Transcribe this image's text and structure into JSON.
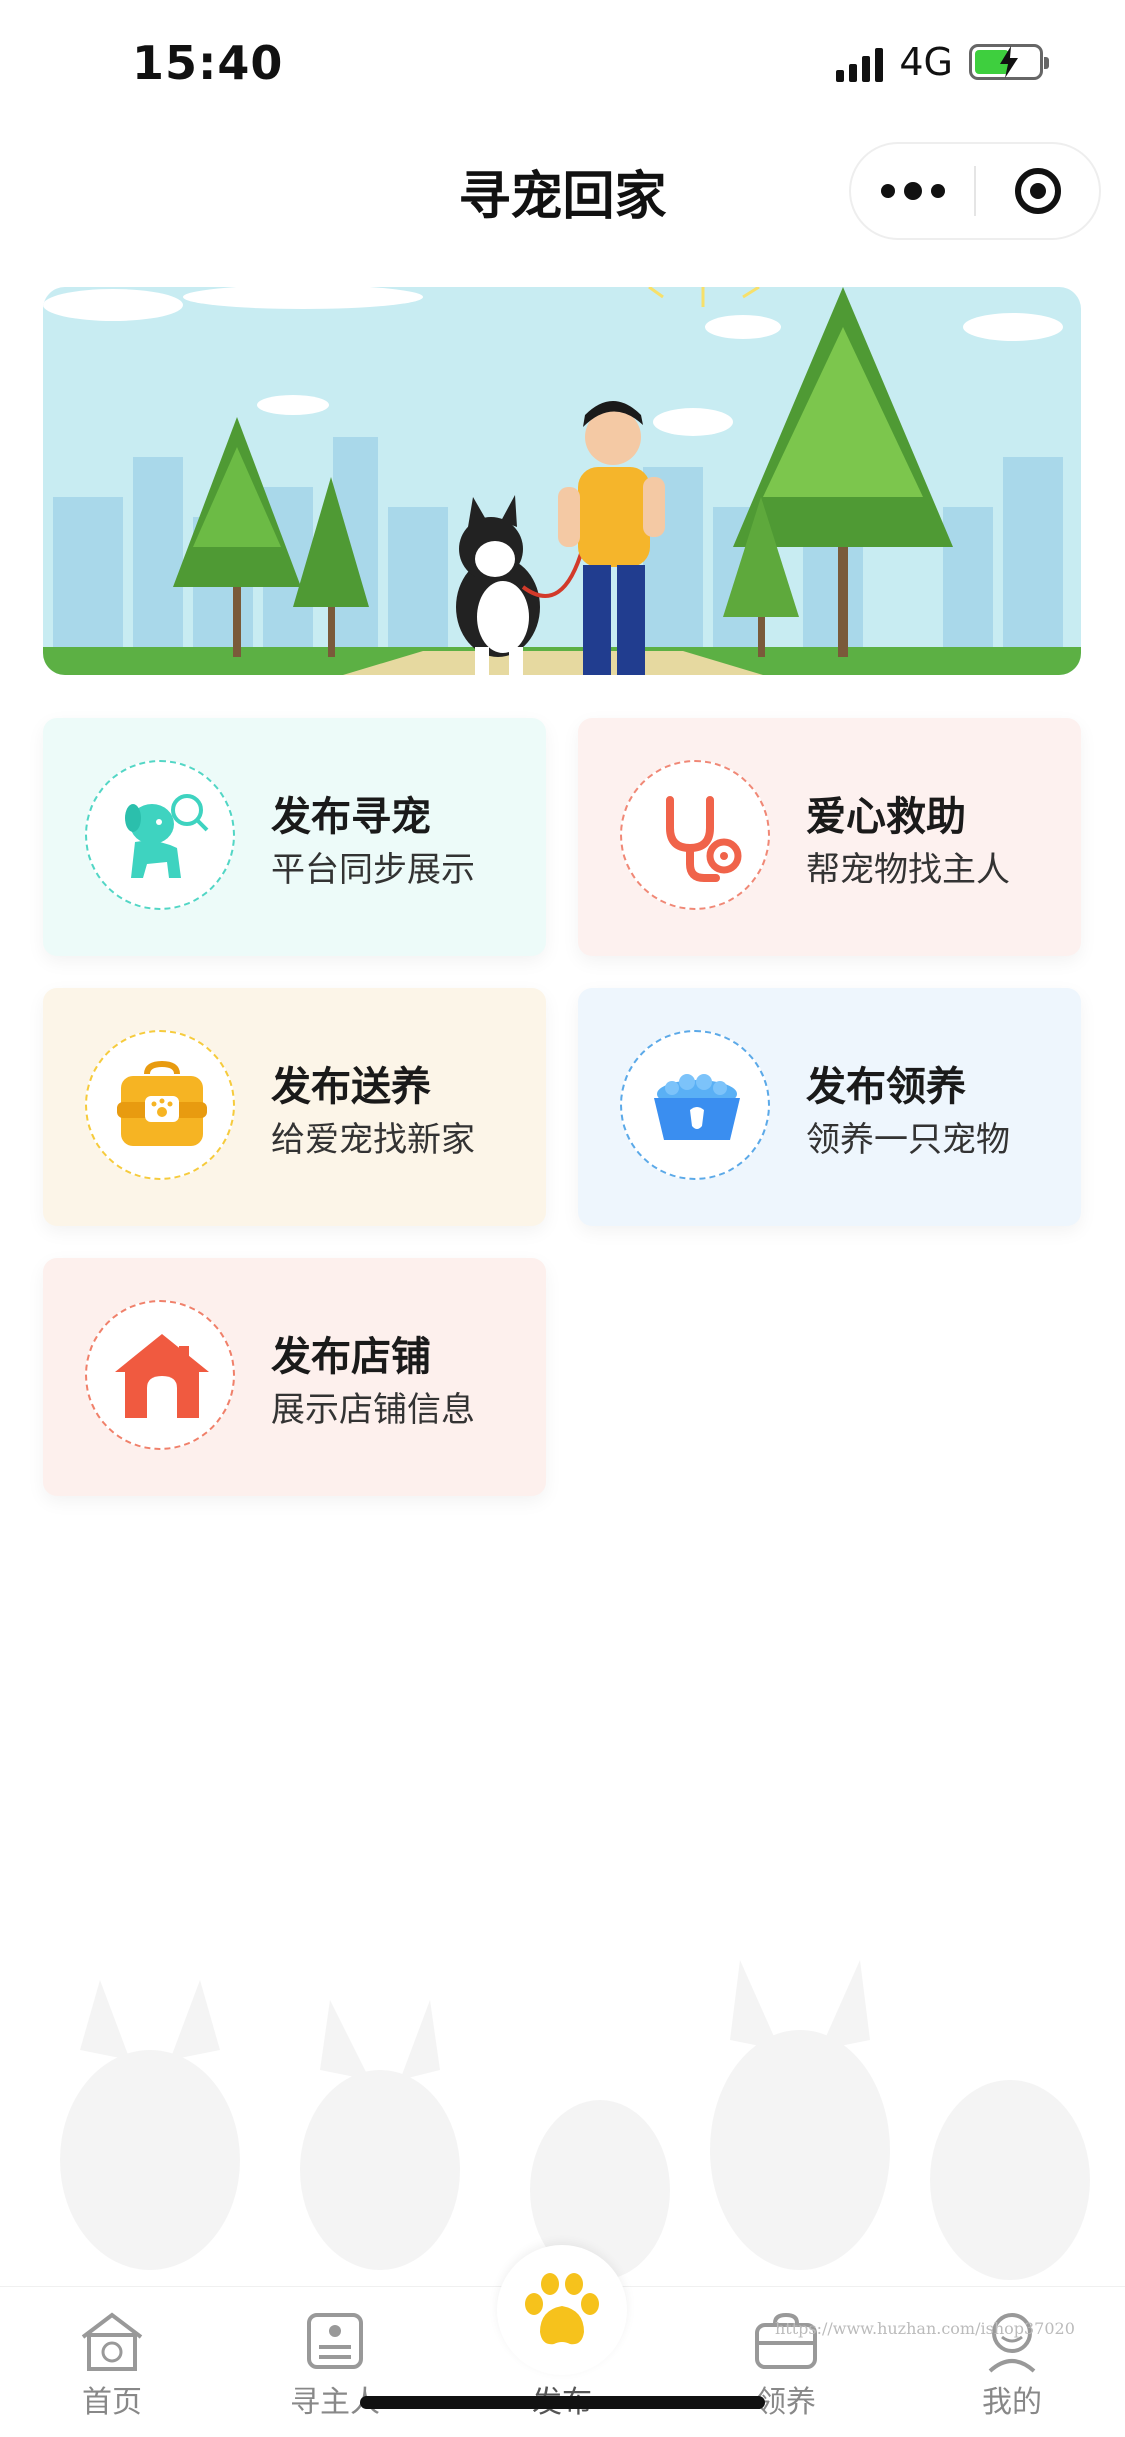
{
  "status_bar": {
    "time": "15:40",
    "network": "4G",
    "icons": [
      "signal-icon",
      "battery-charging-icon"
    ]
  },
  "nav": {
    "title": "寻宠回家",
    "icons": [
      "more-dots-icon",
      "close-target-icon"
    ]
  },
  "banner": {
    "description_icons": [
      "dog-icon",
      "person-icon",
      "tree-icon",
      "city-skyline-icon"
    ]
  },
  "cards": [
    {
      "title": "发布寻宠",
      "subtitle": "平台同步展示",
      "icon": "dog-search-icon",
      "color": "#3ed3c0"
    },
    {
      "title": "爱心救助",
      "subtitle": "帮宠物找主人",
      "icon": "stethoscope-icon",
      "color": "#f0634a"
    },
    {
      "title": "发布送养",
      "subtitle": "给爱宠找新家",
      "icon": "pet-carrier-icon",
      "color": "#f6b423"
    },
    {
      "title": "发布领养",
      "subtitle": "领养一只宠物",
      "icon": "pet-bowl-icon",
      "color": "#3a8ef0"
    },
    {
      "title": "发布店铺",
      "subtitle": "展示店铺信息",
      "icon": "shop-house-icon",
      "color": "#f05a40"
    }
  ],
  "tabs": [
    {
      "label": "首页",
      "icon": "home-icon"
    },
    {
      "label": "寻主人",
      "icon": "find-owner-icon"
    },
    {
      "label": "发布",
      "icon": "paw-icon",
      "active": true
    },
    {
      "label": "领养",
      "icon": "carrier-icon"
    },
    {
      "label": "我的",
      "icon": "profile-icon"
    }
  ],
  "watermark": "https://www.huzhan.com/ishop37020",
  "colors": {
    "accent": "#f6c21c",
    "tab_inactive": "#888888"
  }
}
